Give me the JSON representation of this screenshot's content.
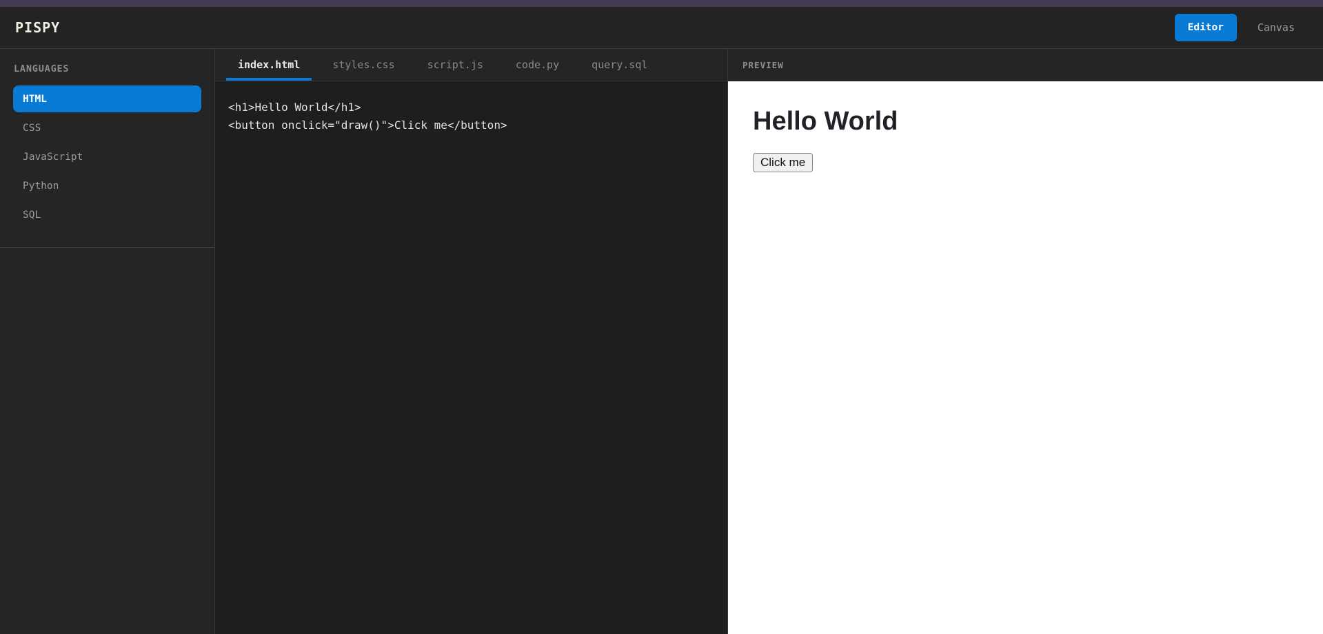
{
  "app": {
    "logo": "PISPY"
  },
  "header": {
    "editor_label": "Editor",
    "canvas_label": "Canvas"
  },
  "sidebar": {
    "title": "LANGUAGES",
    "items": [
      {
        "label": "HTML",
        "selected": true
      },
      {
        "label": "CSS",
        "selected": false
      },
      {
        "label": "JavaScript",
        "selected": false
      },
      {
        "label": "Python",
        "selected": false
      },
      {
        "label": "SQL",
        "selected": false
      }
    ]
  },
  "editor": {
    "tabs": [
      {
        "label": "index.html",
        "active": true
      },
      {
        "label": "styles.css",
        "active": false
      },
      {
        "label": "script.js",
        "active": false
      },
      {
        "label": "code.py",
        "active": false
      },
      {
        "label": "query.sql",
        "active": false
      }
    ],
    "code_lines": [
      "<h1>Hello World</h1>",
      "<button onclick=\"draw()\">Click me</button>"
    ]
  },
  "preview": {
    "title": "PREVIEW",
    "heading": "Hello World",
    "button_label": "Click me"
  },
  "colors": {
    "accent_blue": "#0a7bd4",
    "top_strip": "#443c50",
    "panel_dark": "#252526",
    "code_background": "#1d1e1e"
  }
}
